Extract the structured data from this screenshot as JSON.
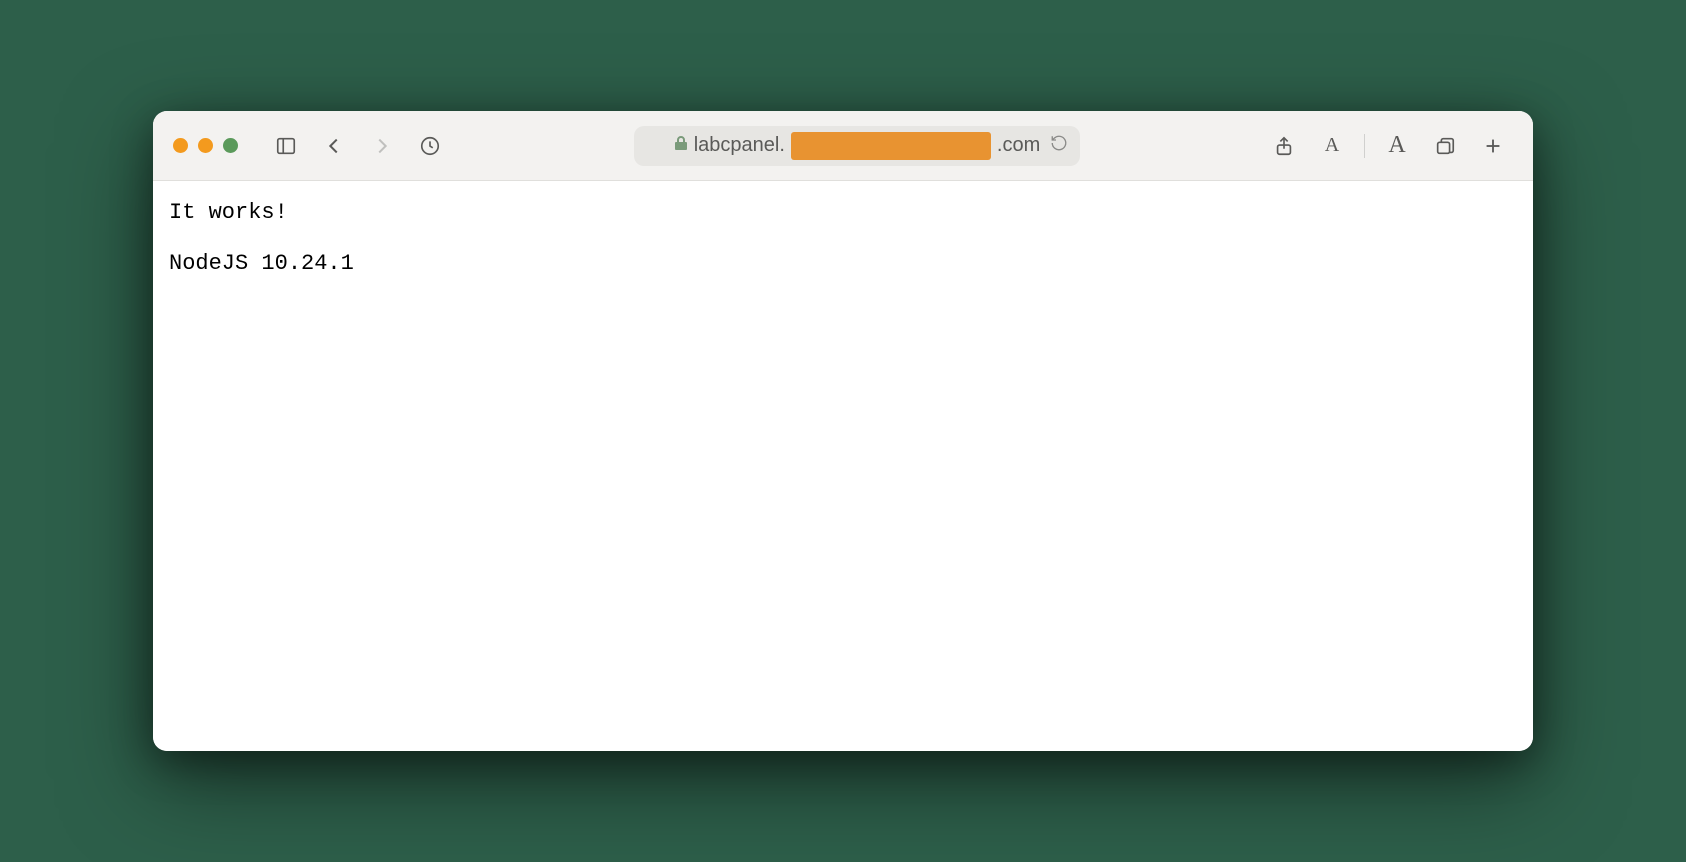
{
  "toolbar": {
    "url_prefix": "labcpanel.",
    "url_suffix": ".com"
  },
  "page": {
    "line1": "It works!",
    "line2": "NodeJS 10.24.1"
  }
}
